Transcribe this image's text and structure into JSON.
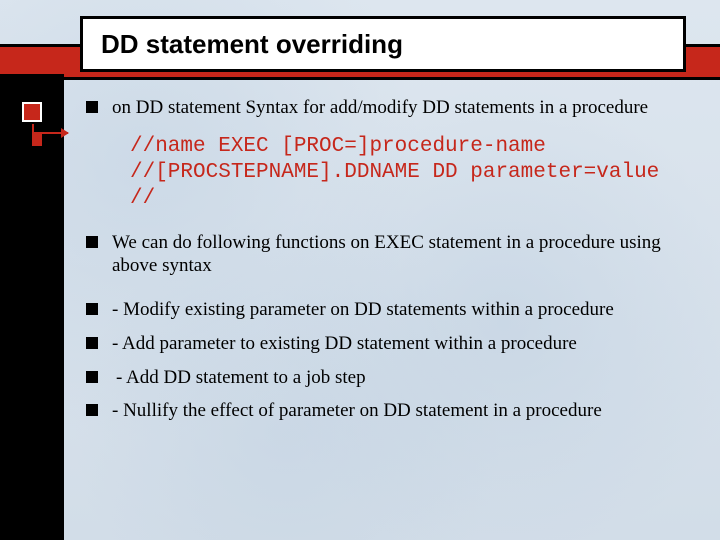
{
  "title": "DD statement overriding",
  "bullets": {
    "b0": "on DD statement Syntax for add/modify DD statements in a procedure",
    "b1": "We can do following functions on EXEC statement in a procedure using above syntax",
    "b2": "- Modify existing parameter on DD statements within a procedure",
    "b3": "- Add parameter to existing DD statement within a procedure",
    "b4": " - Add DD statement to a job step",
    "b5": "- Nullify the effect of parameter on DD statement in a procedure"
  },
  "code": {
    "l0": "//name EXEC [PROC=]procedure-name",
    "l1": "//[PROCSTEPNAME].DDNAME DD parameter=value",
    "l2": "//"
  }
}
